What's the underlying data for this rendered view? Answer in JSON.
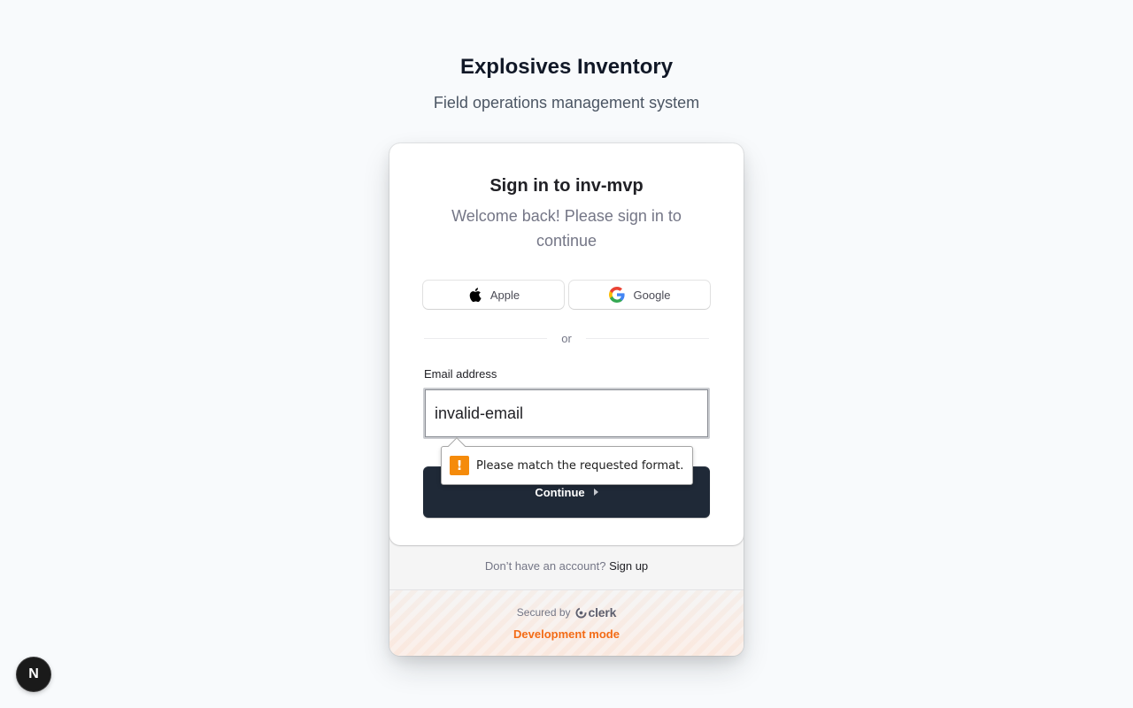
{
  "header": {
    "title": "Explosives Inventory",
    "subtitle": "Field operations management system"
  },
  "signin": {
    "title": "Sign in to inv-mvp",
    "subtitle": "Welcome back! Please sign in to continue",
    "social": [
      {
        "label": "Apple",
        "icon": "apple-icon"
      },
      {
        "label": "Google",
        "icon": "google-icon"
      }
    ],
    "divider": "or",
    "email_label": "Email address",
    "email_value": "invalid-email",
    "continue_label": "Continue",
    "validation_message": "Please match the requested format."
  },
  "footer": {
    "no_account": "Don’t have an account?",
    "sign_up": "Sign up",
    "secured_by": "Secured by",
    "clerk": "clerk",
    "dev_mode": "Development mode"
  },
  "next_badge": "N",
  "colors": {
    "background": "#f8fafc",
    "primary_button": "#1f2937",
    "dev_mode": "#f36b16",
    "warning": "#f58b0b"
  }
}
